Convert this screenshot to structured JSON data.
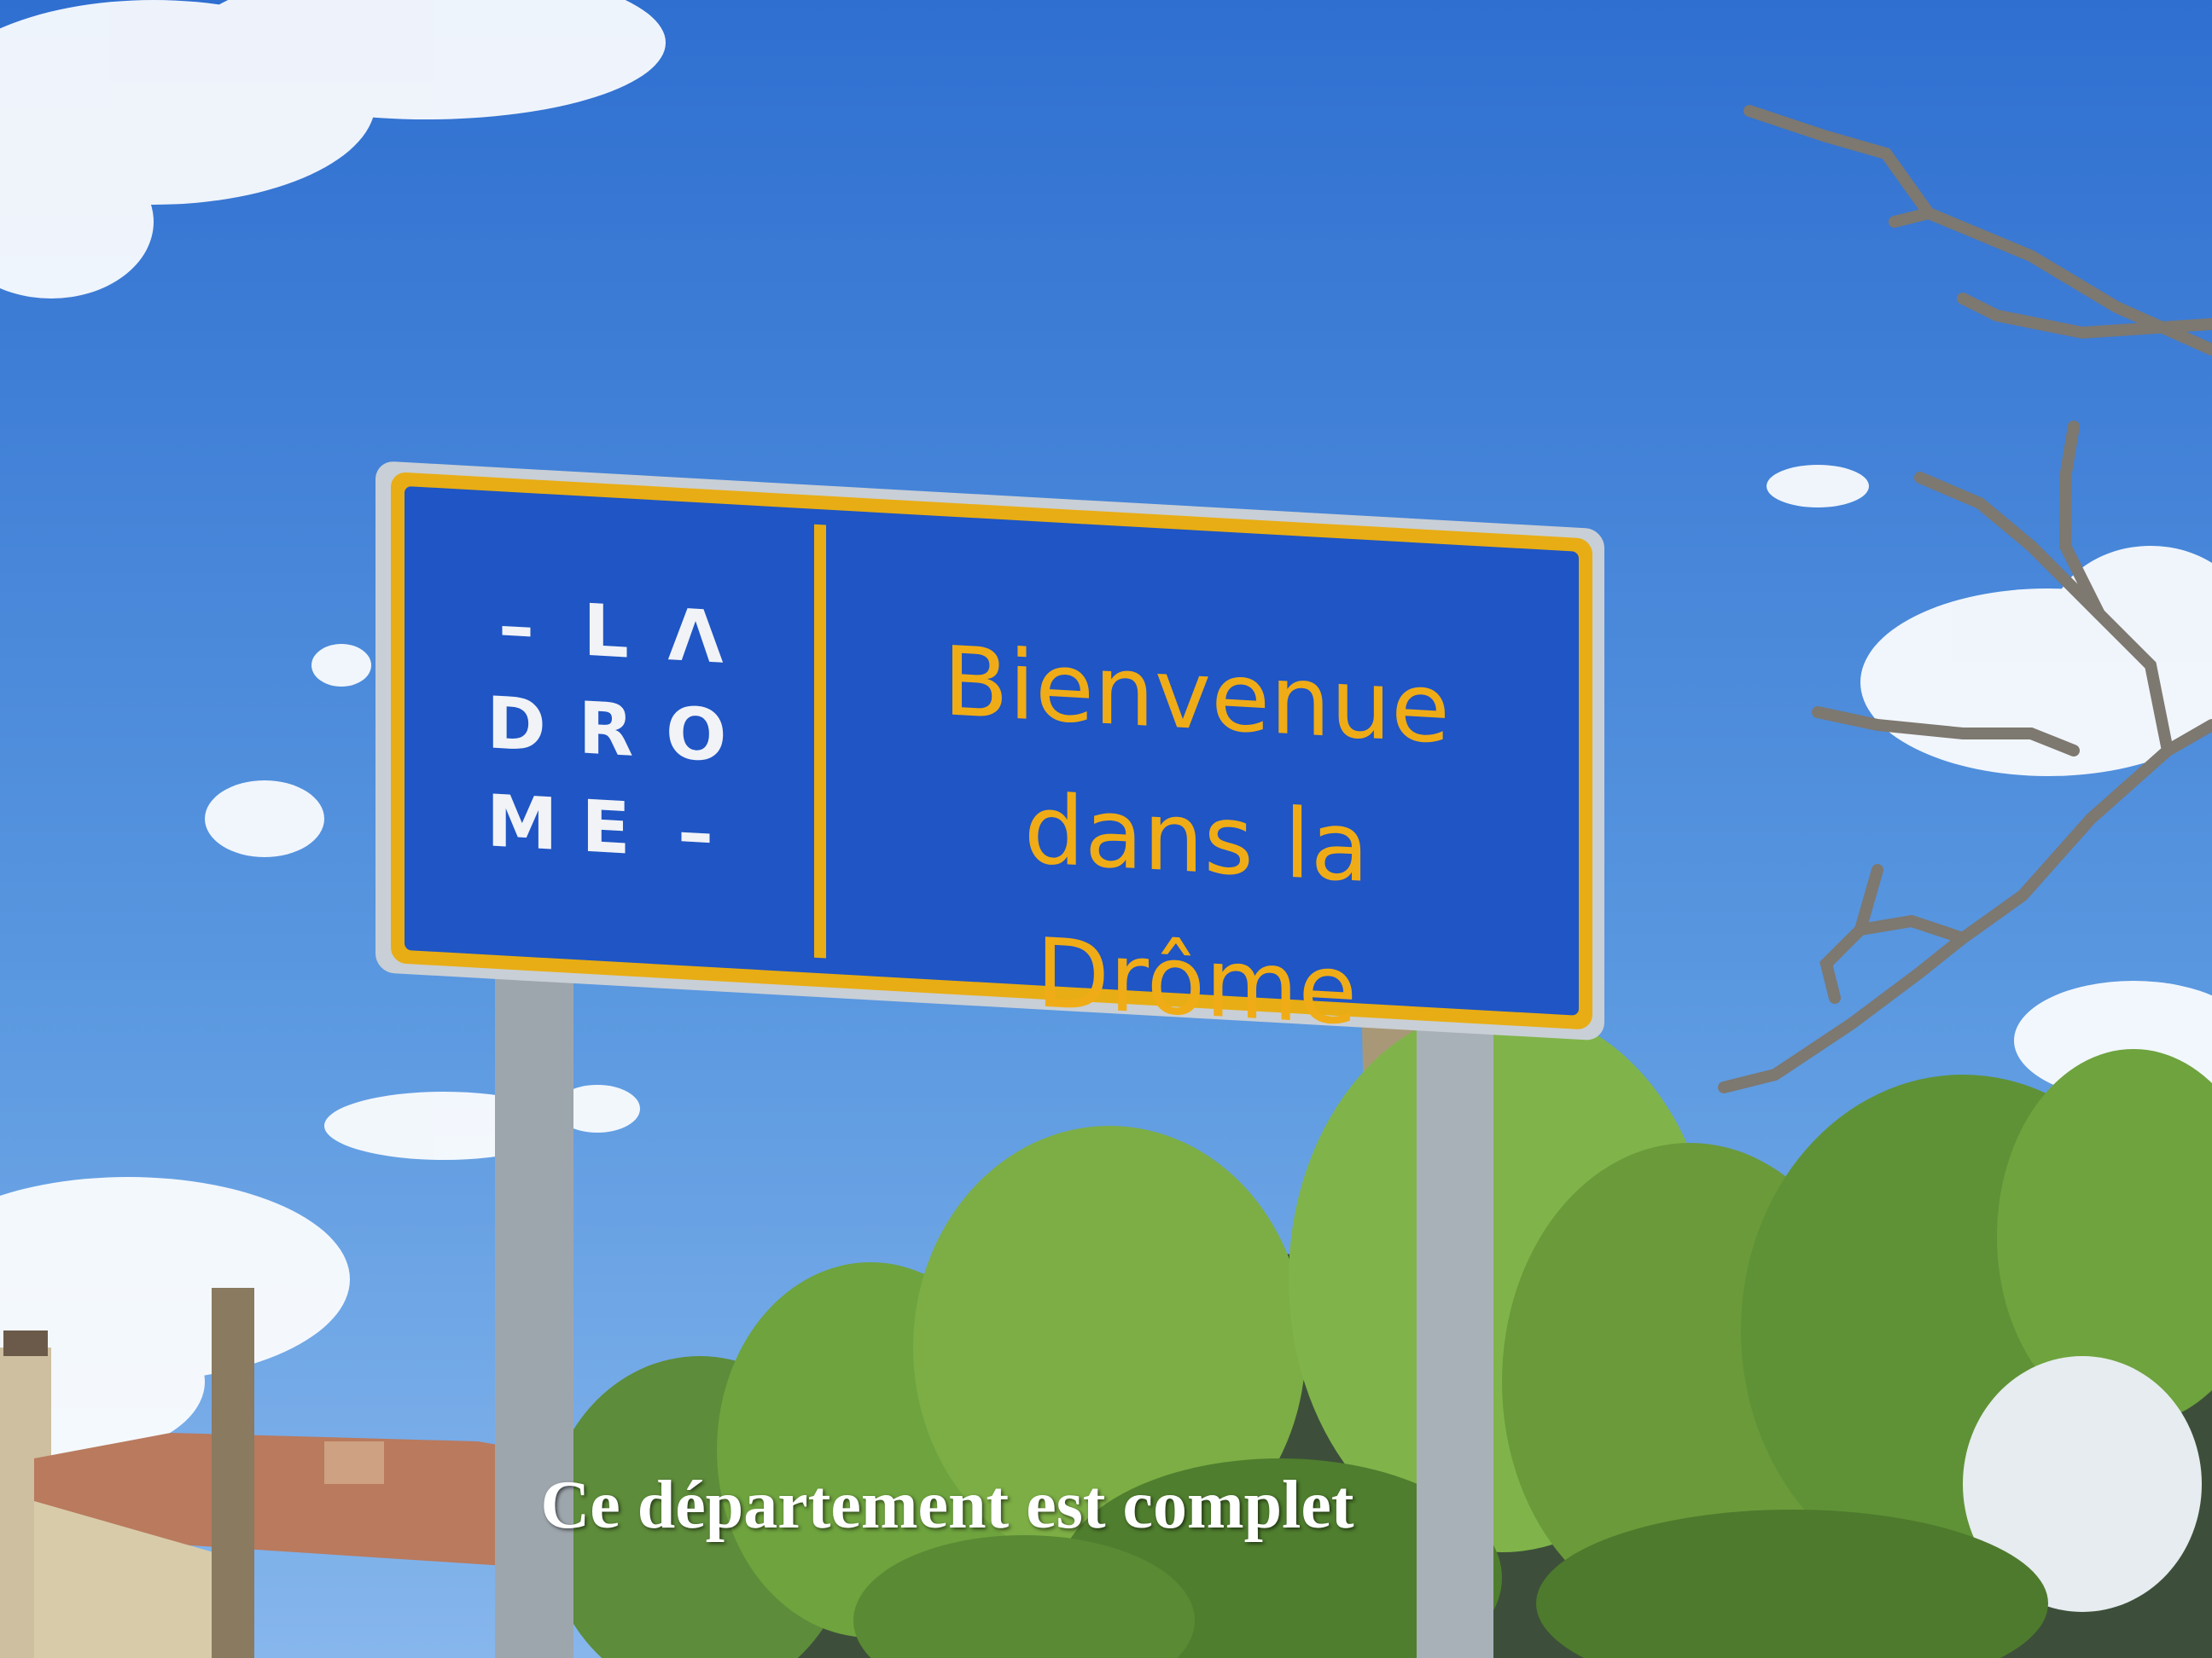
{
  "sign": {
    "logo_rows": [
      [
        "–",
        "L",
        "Λ"
      ],
      [
        "D",
        "R",
        "O"
      ],
      [
        "M",
        "E",
        "–"
      ]
    ],
    "greeting_line1": "Bienvenue",
    "greeting_line2": "dans la Drôme",
    "colors": {
      "panel": "#1f55c4",
      "border": "#e8ad14",
      "text": "#f0ac16",
      "logo_text": "#f1f3f7"
    }
  },
  "caption": "Ce département est complet",
  "colors": {
    "sky": "#4f8ed8",
    "foliage": "#6a9a3a",
    "roof": "#b97a5e"
  }
}
